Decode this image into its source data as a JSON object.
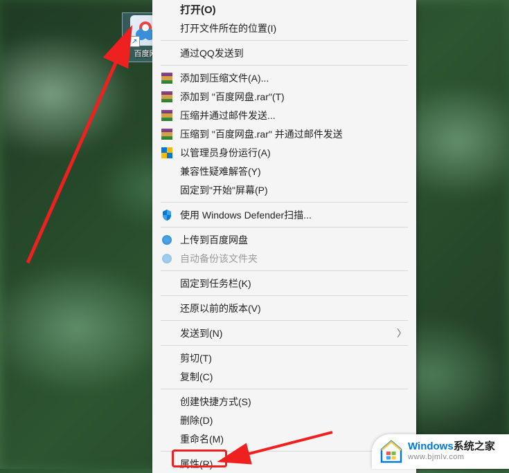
{
  "desktop": {
    "shortcut_label": "百度网"
  },
  "context_menu": {
    "open": "打开(O)",
    "open_file_location": "打开文件所在的位置(I)",
    "qq_send": "通过QQ发送到",
    "add_to_archive": "添加到压缩文件(A)...",
    "add_to_rar": "添加到 \"百度网盘.rar\"(T)",
    "compress_email": "压缩并通过邮件发送...",
    "compress_rar_email": "压缩到 \"百度网盘.rar\" 并通过邮件发送",
    "run_as_admin": "以管理员身份运行(A)",
    "compat_troubleshoot": "兼容性疑难解答(Y)",
    "pin_to_start": "固定到\"开始\"屏幕(P)",
    "defender_scan": "使用 Windows Defender扫描...",
    "upload_baidu": "上传到百度网盘",
    "auto_backup": "自动备份该文件夹",
    "pin_to_taskbar": "固定到任务栏(K)",
    "restore_previous": "还原以前的版本(V)",
    "send_to": "发送到(N)",
    "cut": "剪切(T)",
    "copy": "复制(C)",
    "create_shortcut": "创建快捷方式(S)",
    "delete": "删除(D)",
    "rename": "重命名(M)",
    "properties": "属性(R)"
  },
  "watermark": {
    "brand_en": "Windows",
    "brand_cn": "系统之家",
    "url": "www.bjmlv.com"
  }
}
